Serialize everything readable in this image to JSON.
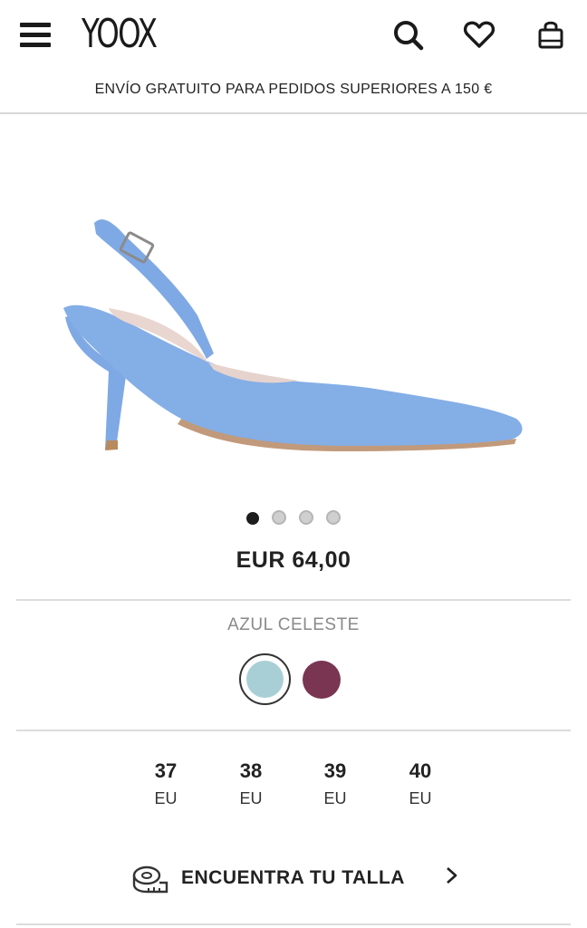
{
  "header": {
    "logo": "YOOX",
    "icons": [
      "menu-icon",
      "search-icon",
      "heart-icon",
      "shopping-bag-icon"
    ]
  },
  "promo": {
    "text": "ENVÍO GRATUITO PARA PEDIDOS SUPERIORES A 150 €"
  },
  "product": {
    "image_subject": "blue suede slingback pump",
    "carousel": {
      "total": 4,
      "active": 1
    },
    "price": "EUR 64,00",
    "color": {
      "selected_name": "AZUL CELESTE",
      "swatches": [
        {
          "color": "#a9cfd6",
          "selected": true
        },
        {
          "color": "#7a3552",
          "selected": false
        }
      ]
    },
    "sizes": [
      {
        "num": "37",
        "unit": "EU"
      },
      {
        "num": "38",
        "unit": "EU"
      },
      {
        "num": "39",
        "unit": "EU"
      },
      {
        "num": "40",
        "unit": "EU"
      }
    ],
    "find_size": {
      "label": "ENCUENTRA TU TALLA",
      "icon": "measuring-tape-icon"
    }
  },
  "colors": {
    "text": "#222222",
    "muted": "#8a8a8a",
    "shoe": "#84aee6"
  }
}
